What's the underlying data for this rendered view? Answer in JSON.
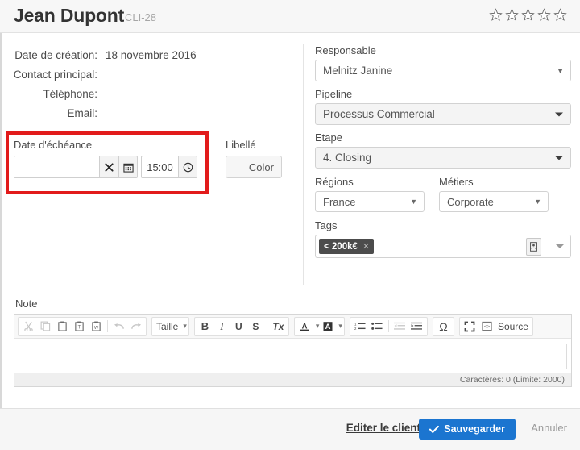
{
  "header": {
    "title": "Jean Dupont",
    "code": "CLI-28",
    "rating_icon": "star-outline-icon",
    "rating_value": 0,
    "rating_max": 5
  },
  "info": {
    "rows": [
      {
        "label": "Date de création:",
        "value": "18 novembre 2016"
      },
      {
        "label": "Contact principal:",
        "value": ""
      },
      {
        "label": "Téléphone:",
        "value": ""
      },
      {
        "label": "Email:",
        "value": ""
      }
    ]
  },
  "due": {
    "label": "Date d'échéance",
    "date_value": "",
    "date_placeholder": "",
    "clear_icon": "close-x-icon",
    "calendar_icon": "calendar-icon",
    "time_value": "15:00",
    "clock_icon": "clock-icon"
  },
  "libelle": {
    "label": "Libellé",
    "button_label": "Color"
  },
  "form": {
    "responsable": {
      "label": "Responsable",
      "value": "Melnitz Janine"
    },
    "pipeline": {
      "label": "Pipeline",
      "value": "Processus Commercial"
    },
    "etape": {
      "label": "Etape",
      "value": "4. Closing"
    },
    "regions": {
      "label": "Régions",
      "value": "France"
    },
    "metiers": {
      "label": "Métiers",
      "value": "Corporate"
    },
    "tags": {
      "label": "Tags",
      "chips": [
        {
          "text": "< 200k€",
          "remove_icon": "close-x-icon"
        }
      ],
      "picker_icon": "contact-card-icon",
      "dropdown_icon": "caret-down-icon"
    }
  },
  "note": {
    "label": "Note",
    "content": "",
    "counter": "Caractères: 0 (Limite: 2000)",
    "toolbar": {
      "clipboard": [
        {
          "name": "cut-icon",
          "glyph": "✂",
          "dim": true
        },
        {
          "name": "copy-icon",
          "glyph": "❐",
          "dim": true
        },
        {
          "name": "paste-icon",
          "glyph": "📋",
          "dim": false
        },
        {
          "name": "paste-text-icon",
          "glyph": "📋",
          "dim": false
        },
        {
          "name": "paste-word-icon",
          "glyph": "📋",
          "dim": false
        },
        {
          "name": "undo-icon",
          "glyph": "↰",
          "dim": true
        },
        {
          "name": "redo-icon",
          "glyph": "↱",
          "dim": true
        }
      ],
      "size_label": "Taille",
      "format": [
        {
          "name": "bold-icon",
          "glyph": "B"
        },
        {
          "name": "italic-icon",
          "glyph": "I"
        },
        {
          "name": "underline-icon",
          "glyph": "U"
        },
        {
          "name": "strikethrough-icon",
          "glyph": "S"
        },
        {
          "name": "remove-format-icon",
          "glyph": "Tx"
        }
      ],
      "color": [
        {
          "name": "text-color-icon",
          "glyph": "A"
        },
        {
          "name": "background-color-icon",
          "glyph": "A"
        }
      ],
      "lists": [
        {
          "name": "numbered-list-icon",
          "glyph": "1."
        },
        {
          "name": "bulleted-list-icon",
          "glyph": "•"
        },
        {
          "name": "outdent-icon",
          "glyph": "⇤"
        },
        {
          "name": "indent-icon",
          "glyph": "⇥"
        }
      ],
      "special_char": {
        "name": "omega-icon",
        "glyph": "Ω"
      },
      "maximize": {
        "name": "maximize-icon",
        "glyph": "⤢"
      },
      "source": {
        "name": "source-icon",
        "label": "Source"
      }
    }
  },
  "footer": {
    "edit_link": "Editer le client",
    "save_label": "Sauvegarder",
    "save_icon": "checkmark-icon",
    "cancel_label": "Annuler"
  },
  "colors": {
    "highlight_border": "#e21b1b",
    "primary_button": "#1b75d0",
    "tag_chip": "#4c4c4c",
    "header_background": "#f7f7f7"
  }
}
